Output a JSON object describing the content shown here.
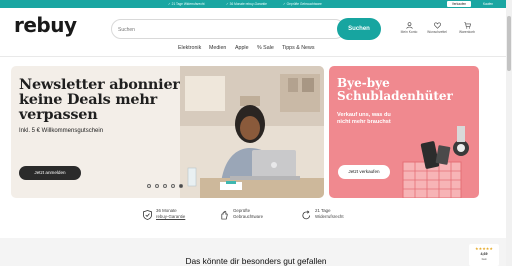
{
  "topbar": {
    "usps": [
      {
        "text": "21 Tage Widerrufsrecht"
      },
      {
        "text": "36 Monate rebuy-Garantie"
      },
      {
        "text": "Geprüfte Gebrauchtware"
      }
    ],
    "buy_label": "Verkaufen",
    "sell_label": "Kaufen"
  },
  "header": {
    "logo": "rebuy",
    "search_placeholder": "Suchen",
    "search_button": "Suchen",
    "account_label": "Mein Konto",
    "wishlist_label": "Wunschzettel",
    "cart_label": "Warenkorb"
  },
  "nav": {
    "items": [
      "Elektronik",
      "Medien",
      "Apple",
      "% Sale",
      "Tipps & News"
    ]
  },
  "hero": {
    "title": "Newsletter abonnieren & keine Deals mehr verpassen",
    "subtitle": "Inkl. 5 € Willkommensgutschein",
    "button": "Jetzt anmelden",
    "slide_count": 5,
    "active_slide": 5
  },
  "promo": {
    "title": "Bye-bye Schubladenhüter",
    "subtitle": "Verkauf uns, was du nicht mehr brauchst",
    "button": "Jetzt verkaufen"
  },
  "usps": [
    {
      "line1": "36 Monate",
      "line2": "rebuy-Garantie",
      "icon": "shield-check-icon"
    },
    {
      "line1": "Geprüfte",
      "line2": "Gebrauchtware",
      "icon": "hand-check-icon"
    },
    {
      "line1": "21 Tage",
      "line2": "Widerrufsrecht",
      "icon": "return-arrow-icon"
    }
  ],
  "section": {
    "title": "Das könnte dir besonders gut gefallen"
  },
  "rating_badge": {
    "stars": "★★★★★",
    "score": "4,69",
    "label": "Gut"
  },
  "colors": {
    "brand_teal": "#17a5a0",
    "promo_pink": "#f0898f",
    "hero_bg": "#f3eee8"
  }
}
